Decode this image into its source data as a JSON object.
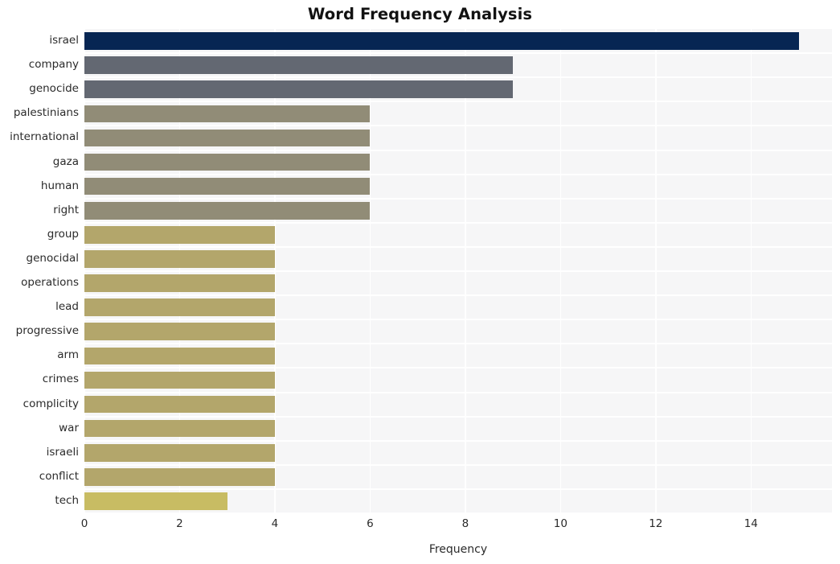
{
  "chart": {
    "title": "Word Frequency Analysis",
    "xlabel": "Frequency",
    "ylabel": ""
  },
  "colors": {
    "background": "#ffffff",
    "plot_background": "#f6f6f7",
    "gridline": "#ffffff",
    "text": "#2b2b2b",
    "title_text": "#121212",
    "bar_navy": "#072653",
    "bar_slate": "#636872",
    "bar_olive": "#918c77",
    "bar_khaki": "#b3a66b",
    "bar_yellow": "#c8bc63"
  },
  "chart_data": {
    "type": "bar",
    "orientation": "horizontal",
    "title": "Word Frequency Analysis",
    "xlabel": "Frequency",
    "ylabel": "",
    "xlim": [
      0,
      15.7
    ],
    "xticks": [
      0,
      2,
      4,
      6,
      8,
      10,
      12,
      14
    ],
    "xtick_labels": [
      "0",
      "2",
      "4",
      "6",
      "8",
      "10",
      "12",
      "14"
    ],
    "grid": true,
    "grid_axis": "x",
    "legend": false,
    "categories": [
      "israel",
      "company",
      "genocide",
      "palestinians",
      "international",
      "gaza",
      "human",
      "right",
      "group",
      "genocidal",
      "operations",
      "lead",
      "progressive",
      "arm",
      "crimes",
      "complicity",
      "war",
      "israeli",
      "conflict",
      "tech"
    ],
    "values": [
      15,
      9,
      9,
      6,
      6,
      6,
      6,
      6,
      4,
      4,
      4,
      4,
      4,
      4,
      4,
      4,
      4,
      4,
      4,
      3
    ],
    "bar_colors": [
      "#072653",
      "#636872",
      "#636872",
      "#918c77",
      "#918c77",
      "#918c77",
      "#918c77",
      "#918c77",
      "#b3a66b",
      "#b3a66b",
      "#b3a66b",
      "#b3a66b",
      "#b3a66b",
      "#b3a66b",
      "#b3a66b",
      "#b3a66b",
      "#b3a66b",
      "#b3a66b",
      "#b3a66b",
      "#c8bc63"
    ]
  }
}
